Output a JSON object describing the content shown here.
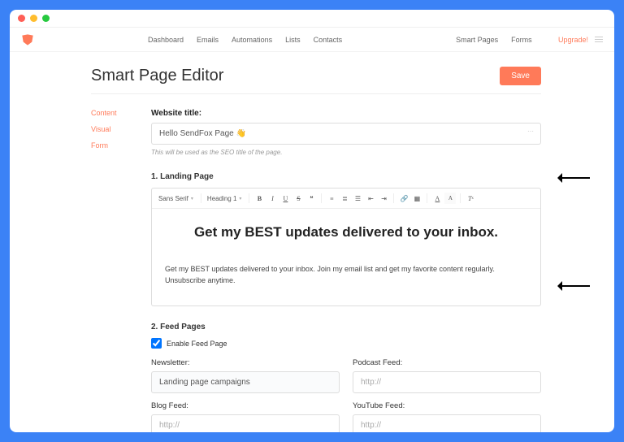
{
  "nav": {
    "dashboard": "Dashboard",
    "emails": "Emails",
    "automations": "Automations",
    "lists": "Lists",
    "contacts": "Contacts",
    "smartpages": "Smart Pages",
    "forms": "Forms",
    "upgrade": "Upgrade!"
  },
  "page": {
    "title": "Smart Page Editor",
    "save": "Save"
  },
  "tabs": {
    "content": "Content",
    "visual": "Visual",
    "form": "Form"
  },
  "website_title": {
    "label": "Website title:",
    "value": "Hello SendFox Page 👋",
    "hint": "This will be used as the SEO title of the page."
  },
  "landing": {
    "heading": "1. Landing Page",
    "font": "Sans Serif",
    "style": "Heading 1",
    "headline": "Get my BEST updates delivered to your inbox.",
    "body": "Get my BEST updates delivered to your inbox. Join my email list and get my favorite content regularly. Unsubscribe anytime."
  },
  "feed": {
    "heading": "2. Feed Pages",
    "enable": "Enable Feed Page",
    "newsletter_label": "Newsletter:",
    "newsletter_value": "Landing page campaigns",
    "podcast_label": "Podcast Feed:",
    "blog_label": "Blog Feed:",
    "youtube_label": "YouTube Feed:",
    "placeholder": "http://"
  }
}
